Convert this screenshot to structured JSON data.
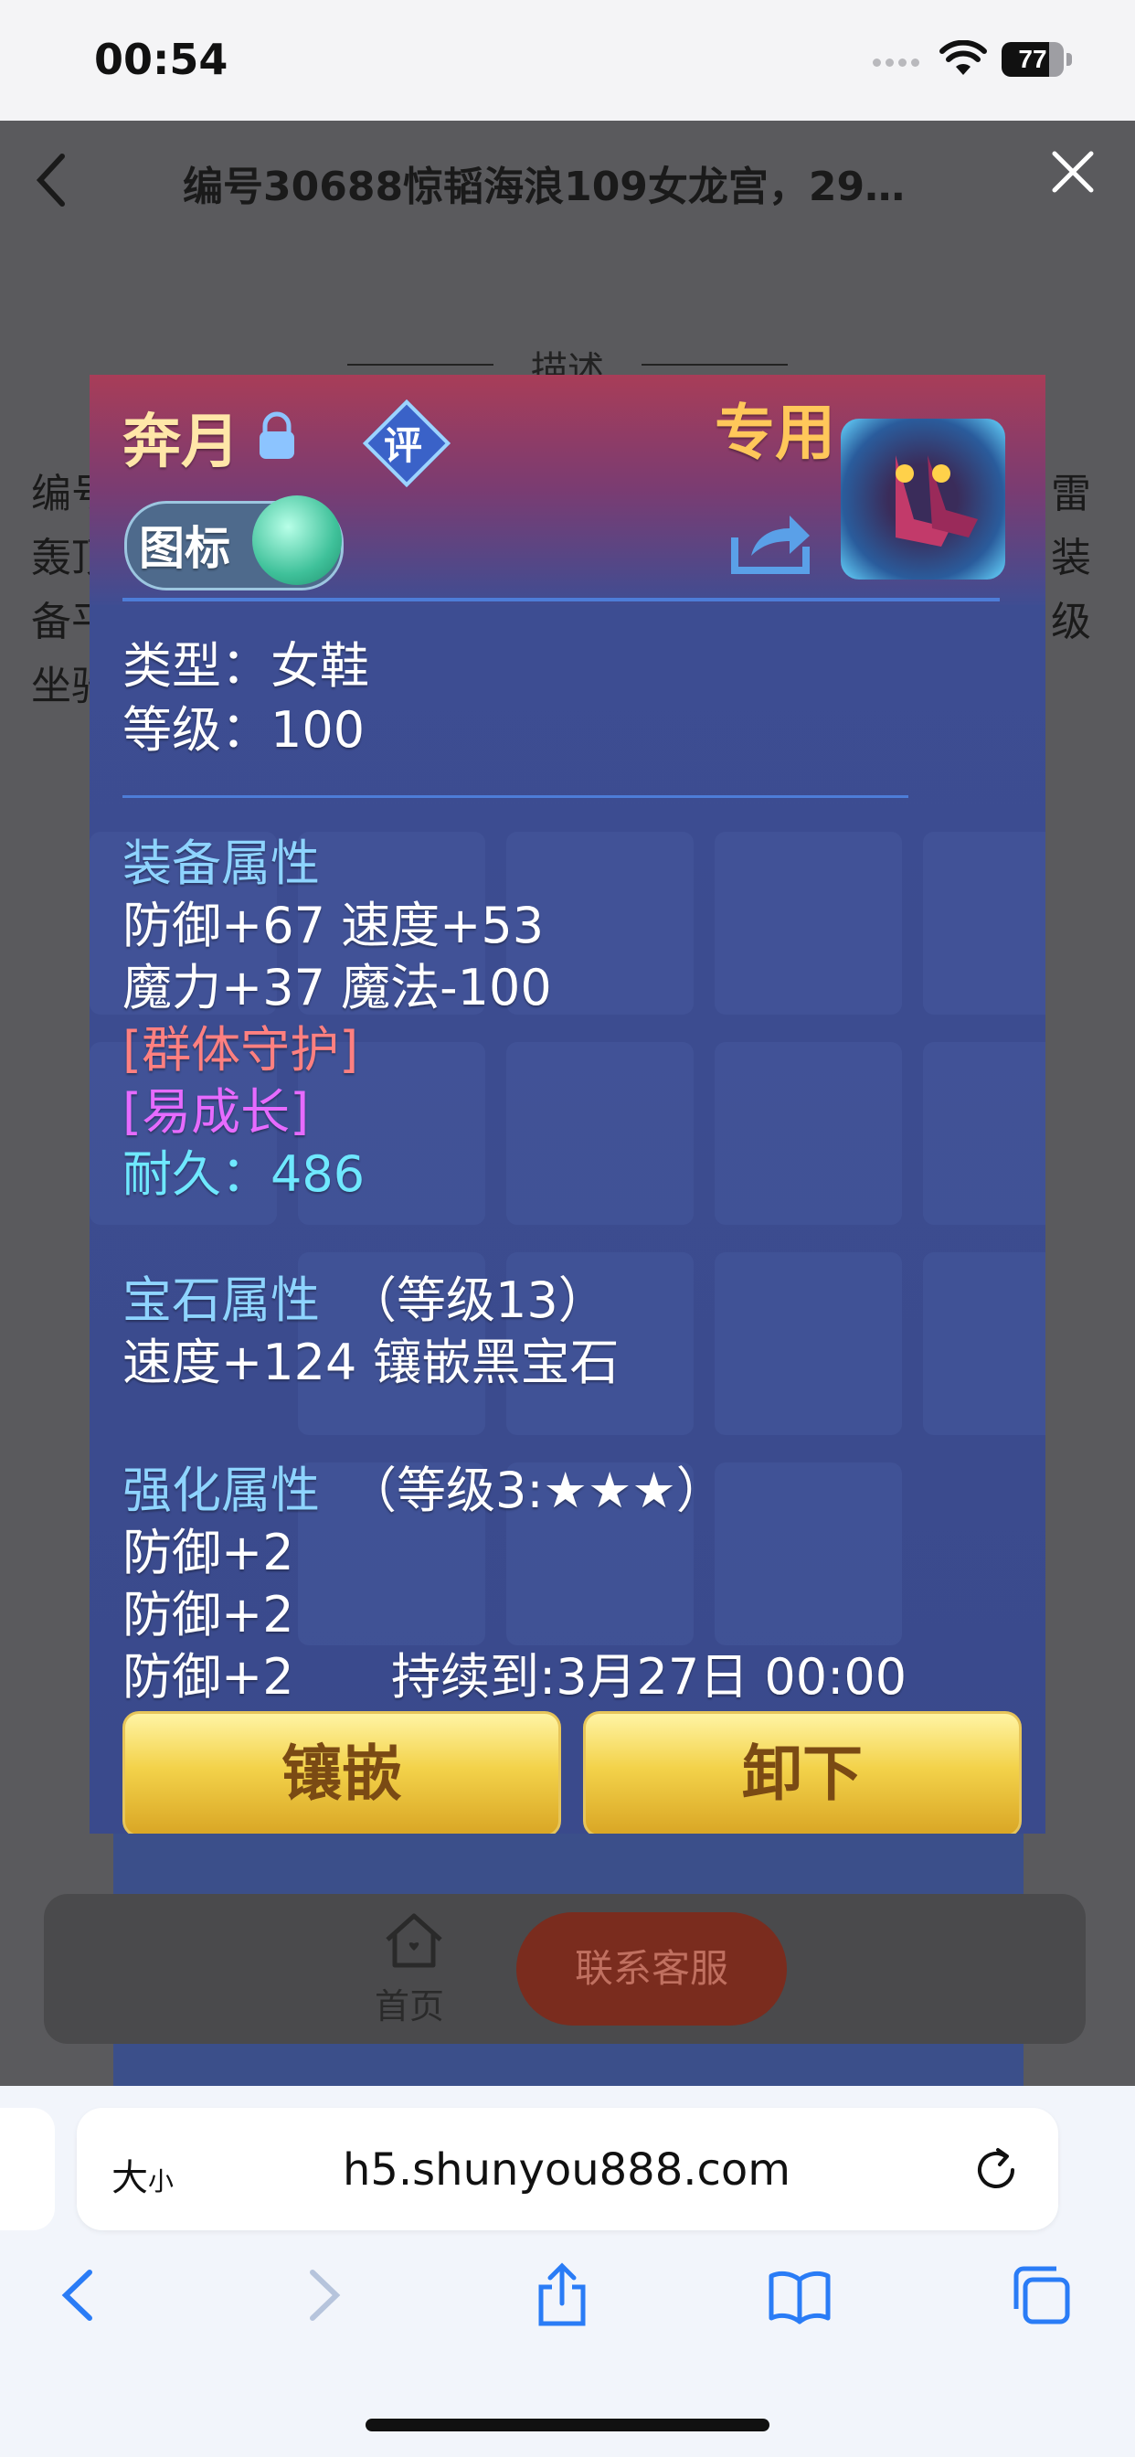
{
  "status_bar": {
    "time": "00:54",
    "battery": "77",
    "battery_level": 0.77
  },
  "header": {
    "title": "编号30688惊韬海浪109女龙宫，29…"
  },
  "section": {
    "desc_label": "描述"
  },
  "background_text": {
    "line1_left": "编号",
    "line1_right": "雷",
    "line2_left": "轰顶",
    "line2_right": "装",
    "line3_left": "备平",
    "line3_right": "级",
    "line4_left": "坐骑"
  },
  "item": {
    "name": "奔月",
    "rate_badge": "评",
    "exclusive": "专用",
    "toggle_label": "图标",
    "type": "类型：女鞋",
    "level": "等级：100",
    "equip_attr_title": "装备属性",
    "equip_line1": "防御+67 速度+53",
    "equip_line2": "魔力+37 魔法-100",
    "special1": "[群体守护]",
    "special2": "[易成长]",
    "durability": "耐久：486",
    "gem_title": "宝石属性",
    "gem_level": "（等级13）",
    "gem_line": "速度+124 镶嵌黑宝石",
    "enhance_title": "强化属性",
    "enhance_level": "（等级3:★★★）",
    "enhance_line1": "防御+2",
    "enhance_line2": "防御+2",
    "enhance_line3": "防御+2",
    "expires": "持续到:3月27日 00:00",
    "btn_inlay": "镶嵌",
    "btn_unequip": "卸下"
  },
  "bottom_nav": {
    "home": "首页",
    "contact": "联系客服"
  },
  "safari": {
    "aa_big": "大",
    "aa_small": "小",
    "url": "h5.shunyou888.com"
  }
}
